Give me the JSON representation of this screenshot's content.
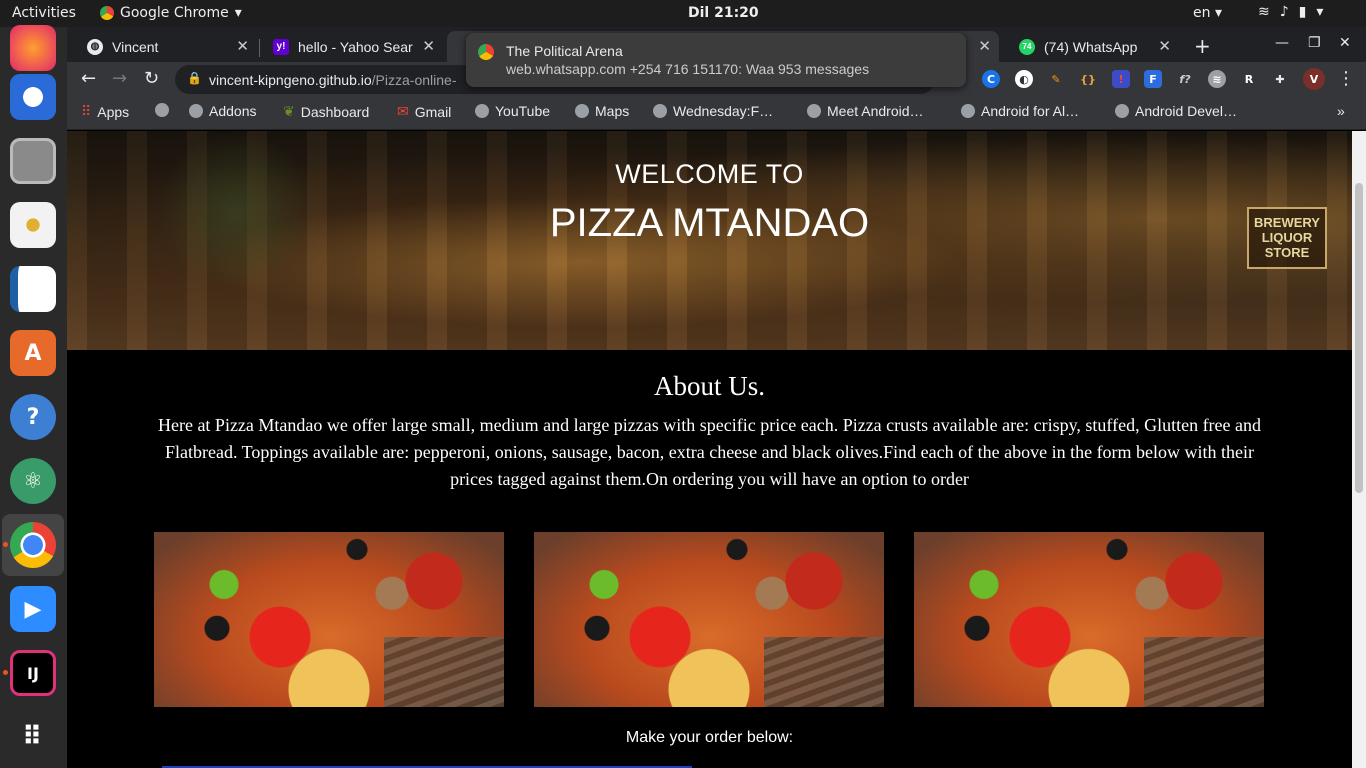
{
  "system": {
    "activities": "Activities",
    "app_name": "Google Chrome",
    "clock": "Dil 21:20",
    "language": "en"
  },
  "dock": {
    "apps": [
      "Firefox",
      "Thunderbird",
      "Files",
      "Rhythmbox",
      "LibreOffice Writer",
      "Ubuntu Software",
      "Help",
      "Atom",
      "Google Chrome",
      "Zoom",
      "IntelliJ IDEA",
      "Show Applications"
    ]
  },
  "tabs": [
    {
      "title": "Vincent",
      "active": false
    },
    {
      "title": "hello - Yahoo Sear",
      "active": false
    },
    {
      "title": "",
      "active": true
    },
    {
      "title": "(74) WhatsApp",
      "active": false
    }
  ],
  "toolbar": {
    "url_host": "vincent-kipngeno.github.io",
    "url_path": "/Pizza-online-"
  },
  "bookmarks": [
    {
      "label": "Apps"
    },
    {
      "label": ""
    },
    {
      "label": "Addons"
    },
    {
      "label": "Dashboard"
    },
    {
      "label": "Gmail"
    },
    {
      "label": "YouTube"
    },
    {
      "label": "Maps"
    },
    {
      "label": "Wednesday:F…"
    },
    {
      "label": "Meet Android…"
    },
    {
      "label": "Android for Al…"
    },
    {
      "label": "Android Devel…"
    }
  ],
  "notification": {
    "title": "The Political Arena",
    "body": "web.whatsapp.com  +254 716 151170: Waa 953 messages"
  },
  "page": {
    "hero": {
      "welcome": "WELCOME TO",
      "brand": "PIZZA MTANDAO",
      "sign": "BREWERY LIQUOR STORE"
    },
    "about": {
      "title": "About Us.",
      "text": "Here at Pizza Mtandao we offer large small, medium and large pizzas with specific price each. Pizza crusts available are: crispy, stuffed, Glutten free and Flatbread. Toppings available are: pepperoni, onions, sausage, bacon, extra cheese and black olives.Find each of the above in the form below with their prices tagged against them.On ordering you will have an option to order"
    },
    "order_cta": "Make your order below:"
  }
}
